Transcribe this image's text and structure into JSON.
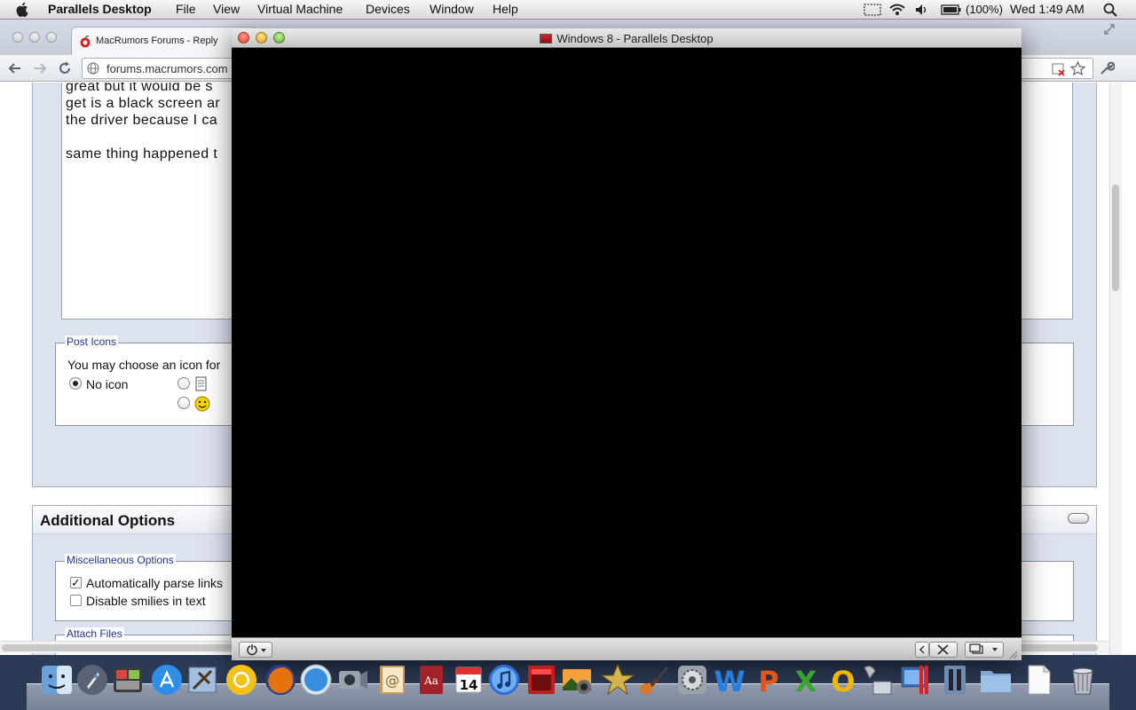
{
  "menubar": {
    "app_name": "Parallels Desktop",
    "menus": [
      "File",
      "View",
      "Virtual Machine",
      "Devices",
      "Window",
      "Help"
    ],
    "battery": "(100%)",
    "clock": "Wed 1:49 AM"
  },
  "browser": {
    "tab_title": "MacRumors Forums - Reply",
    "url": "forums.macrumors.com",
    "editor_lines": [
      "great but it would be s",
      "get is a black screen ar",
      "the driver because I ca",
      "",
      "same thing happened t"
    ],
    "post_icons": {
      "legend": "Post Icons",
      "intro": "You may choose an icon for",
      "no_icon_label": "No icon"
    },
    "additional_options": {
      "heading": "Additional Options",
      "misc_legend": "Miscellaneous Options",
      "parse_links_label": "Automatically parse links",
      "parse_links_checked": true,
      "disable_smilies_label": "Disable smilies in text",
      "disable_smilies_checked": false,
      "attach_legend": "Attach Files"
    }
  },
  "vm_window": {
    "title": "Windows 8 - Parallels Desktop",
    "screen_color": "#000000"
  },
  "dock": {
    "icons": [
      "finder-icon",
      "launchpad-icon",
      "photo-booth-icon",
      "app-store-icon",
      "mail-icon",
      "chrome-icon",
      "firefox-icon",
      "safari-icon",
      "facetime-icon",
      "address-book-icon",
      "dictionary-icon",
      "calendar-icon",
      "itunes-icon",
      "photo-booth-icon-2",
      "iphoto-icon",
      "imovie-icon",
      "garageband-icon",
      "system-preferences-icon",
      "word-icon",
      "powerpoint-icon",
      "excel-icon",
      "outlook-icon",
      "network-icon",
      "parallels-icon",
      "parallels-vm-icon",
      "applications-folder-icon",
      "document-icon",
      "trash-icon"
    ],
    "calendar_day": "14"
  }
}
